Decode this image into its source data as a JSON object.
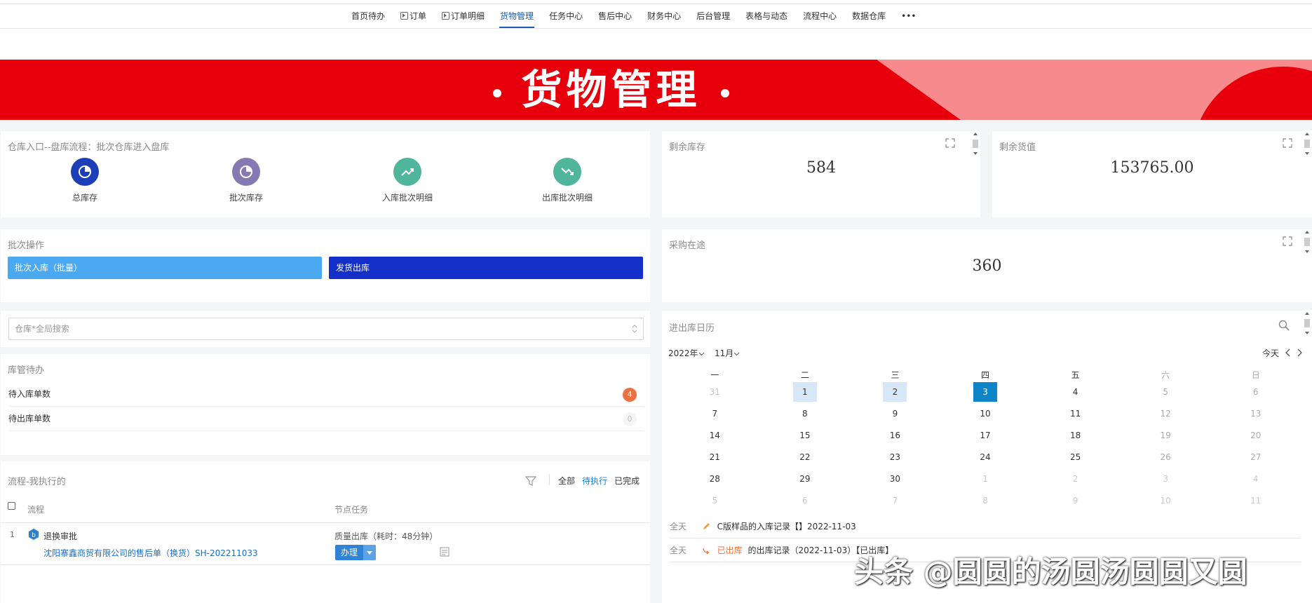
{
  "nav": {
    "items": [
      {
        "label": "首页待办",
        "icon": false
      },
      {
        "label": "订单",
        "icon": true
      },
      {
        "label": "订单明细",
        "icon": true
      },
      {
        "label": "货物管理",
        "icon": false,
        "active": true
      },
      {
        "label": "任务中心",
        "icon": false
      },
      {
        "label": "售后中心",
        "icon": false
      },
      {
        "label": "财务中心",
        "icon": false
      },
      {
        "label": "后台管理",
        "icon": false
      },
      {
        "label": "表格与动态",
        "icon": false
      },
      {
        "label": "流程中心",
        "icon": false
      },
      {
        "label": "数据仓库",
        "icon": false
      },
      {
        "label": "•••",
        "icon": false
      }
    ]
  },
  "banner": {
    "title": "货物管理"
  },
  "warehouse": {
    "title": "仓库入口--盘库流程：批次仓库进入盘库",
    "icons": [
      {
        "label": "总库存",
        "color": "#1c3fb8",
        "icon": "pie-chart-icon"
      },
      {
        "label": "批次库存",
        "color": "#8479b3",
        "icon": "pie-chart-icon"
      },
      {
        "label": "入库批次明细",
        "color": "#4fb59b",
        "icon": "trend-up-icon"
      },
      {
        "label": "出库批次明细",
        "color": "#4fb59b",
        "icon": "trend-down-icon"
      }
    ]
  },
  "stock": {
    "title": "剩余库存",
    "value": "584"
  },
  "goods_value": {
    "title": "剩余货值",
    "value": "153765.00"
  },
  "batch": {
    "title": "批次操作",
    "in_label": "批次入库（批量）",
    "out_label": "发货出库"
  },
  "purchase": {
    "title": "采购在途",
    "value": "360"
  },
  "search": {
    "placeholder": "仓库*全局搜索"
  },
  "todo": {
    "title": "库管待办",
    "rows": [
      {
        "label": "待入库单数",
        "count": "4"
      },
      {
        "label": "待出库单数",
        "count": "0"
      }
    ]
  },
  "flow": {
    "title": "流程-我执行的",
    "filters": {
      "all": "全部",
      "pending": "待执行",
      "done": "已完成"
    },
    "col_flow": "流程",
    "col_task": "节点任务",
    "row": {
      "index": "1",
      "name": "退换审批",
      "link": "沈阳寨鑫商贸有限公司的售后单（换货）SH-202211033",
      "task": "质量出库（耗时：48分钟）",
      "action": "办理"
    }
  },
  "calendar": {
    "title": "进出库日历",
    "year": "2022年",
    "month": "11月",
    "today_label": "今天",
    "weekdays": [
      "一",
      "二",
      "三",
      "四",
      "五",
      "六",
      "日"
    ],
    "weeks": [
      [
        "31",
        "1",
        "2",
        "3",
        "4",
        "5",
        "6"
      ],
      [
        "7",
        "8",
        "9",
        "10",
        "11",
        "12",
        "13"
      ],
      [
        "14",
        "15",
        "16",
        "17",
        "18",
        "19",
        "20"
      ],
      [
        "21",
        "22",
        "23",
        "24",
        "25",
        "26",
        "27"
      ],
      [
        "28",
        "29",
        "30",
        "1",
        "2",
        "3",
        "4"
      ],
      [
        "5",
        "6",
        "7",
        "8",
        "9",
        "10",
        "11"
      ]
    ],
    "events": [
      {
        "tag": "全天",
        "text": "C版样品的入库记录【】2022-11-03"
      },
      {
        "tag": "全天",
        "status": "已出库",
        "text": "的出库记录（2022-11-03）【已出库】"
      }
    ]
  },
  "watermark": "头条 @圆圆的汤圆汤圆圆又圆",
  "colors": {
    "accent": "#1a5fb4",
    "banner_red": "#e7000b",
    "btn_in": "#4aa9f0",
    "btn_out": "#1530c9",
    "today": "#0f85c9",
    "badge": "#ee7040"
  }
}
